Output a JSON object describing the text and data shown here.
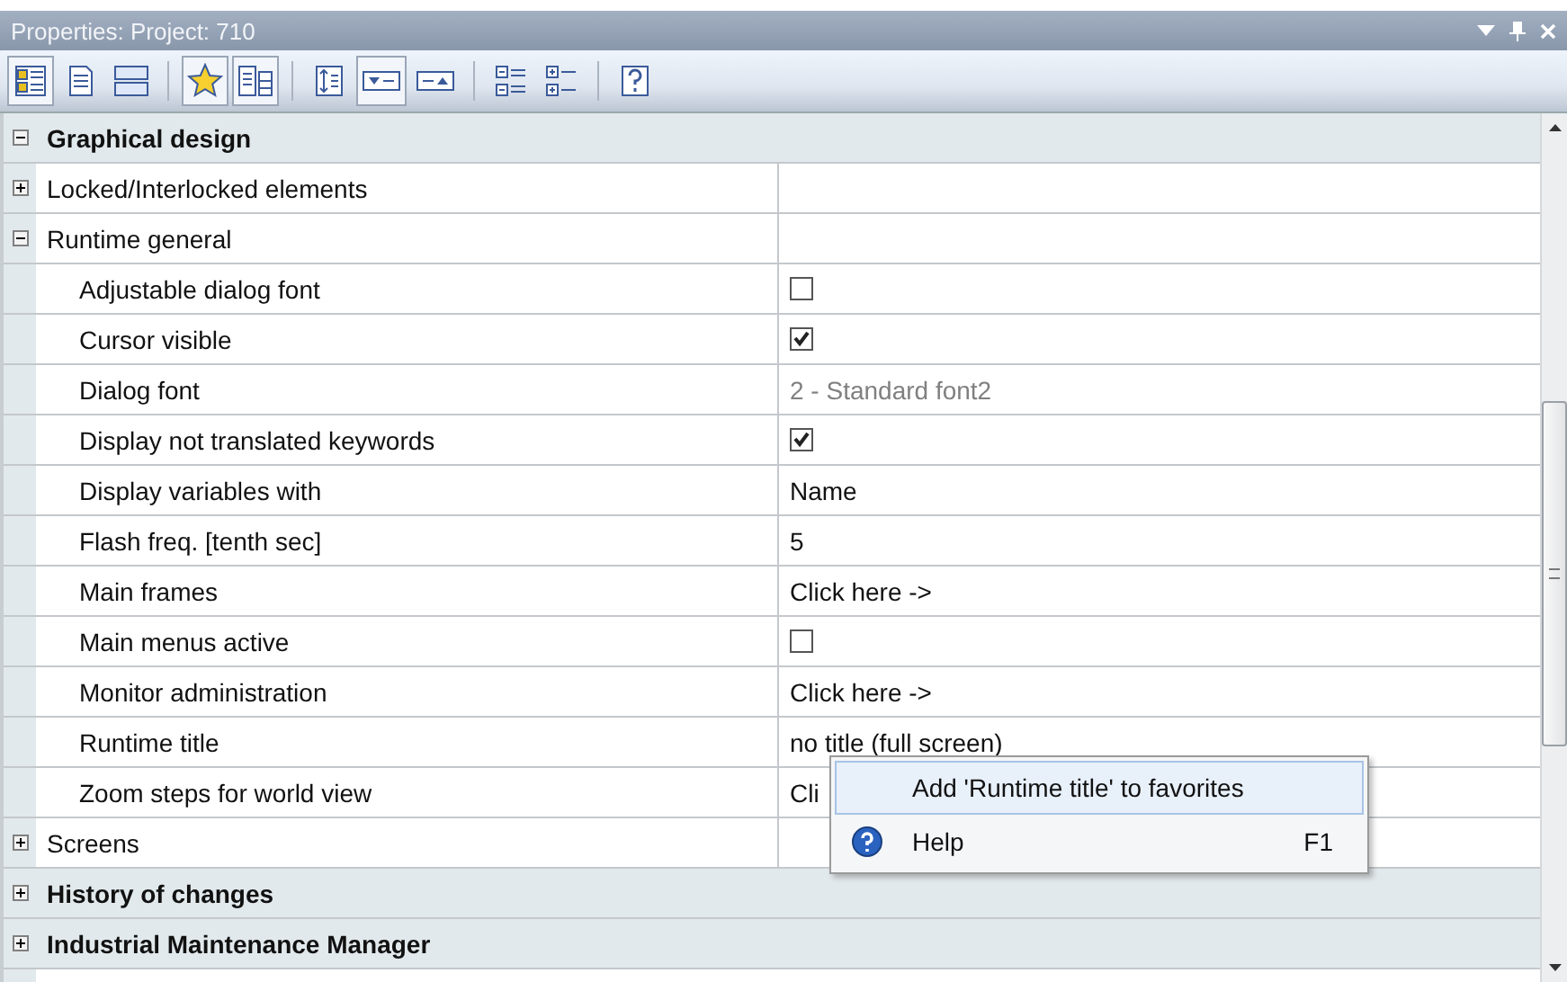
{
  "window": {
    "title": "Properties: Project: 710"
  },
  "toolbar": {
    "groups": [
      [
        {
          "kind": "categorized",
          "pressed": true
        },
        {
          "kind": "pages",
          "pressed": false
        },
        {
          "kind": "rows",
          "pressed": false
        }
      ],
      [
        {
          "kind": "favorites",
          "pressed": true
        },
        {
          "kind": "docgrid",
          "pressed": true
        }
      ],
      [
        {
          "kind": "height",
          "pressed": false
        },
        {
          "kind": "dropdown",
          "pressed": true
        },
        {
          "kind": "dropup",
          "pressed": false
        }
      ],
      [
        {
          "kind": "collapse",
          "pressed": false
        },
        {
          "kind": "expand",
          "pressed": false
        }
      ],
      [
        {
          "kind": "help",
          "pressed": false
        }
      ]
    ]
  },
  "tree": [
    {
      "kind": "category",
      "label": "Graphical design",
      "expanded": true,
      "children": [
        {
          "kind": "group",
          "label": "Locked/Interlocked elements",
          "expanded": false
        },
        {
          "kind": "group",
          "label": "Runtime general",
          "expanded": true,
          "children": [
            {
              "kind": "checkbox",
              "label": "Adjustable dialog font",
              "checked": false
            },
            {
              "kind": "checkbox",
              "label": "Cursor visible",
              "checked": true
            },
            {
              "kind": "text",
              "label": "Dialog font",
              "value": "2 - Standard font2",
              "greyed": true
            },
            {
              "kind": "checkbox",
              "label": "Display not translated keywords",
              "checked": true
            },
            {
              "kind": "text",
              "label": "Display variables with",
              "value": "Name",
              "greyed": false
            },
            {
              "kind": "text",
              "label": "Flash freq. [tenth sec]",
              "value": "5",
              "greyed": false
            },
            {
              "kind": "text",
              "label": "Main frames",
              "value": "Click here ->",
              "greyed": false
            },
            {
              "kind": "checkbox",
              "label": "Main menus active",
              "checked": false
            },
            {
              "kind": "text",
              "label": "Monitor administration",
              "value": "Click here ->",
              "greyed": false
            },
            {
              "kind": "text",
              "label": "Runtime title",
              "value": "no title (full screen)",
              "greyed": false
            },
            {
              "kind": "text",
              "label": "Zoom steps for world view",
              "value": "Cli",
              "greyed": false
            }
          ]
        },
        {
          "kind": "group",
          "label": "Screens",
          "expanded": false
        }
      ]
    },
    {
      "kind": "category",
      "label": "History of changes",
      "expanded": false
    },
    {
      "kind": "category",
      "label": "Industrial Maintenance Manager",
      "expanded": false
    }
  ],
  "context_menu": {
    "items": [
      {
        "kind": "favorite",
        "label": "Add 'Runtime title' to favorites",
        "selected": true
      },
      {
        "kind": "help",
        "label": "Help",
        "shortcut": "F1",
        "selected": false
      }
    ]
  }
}
